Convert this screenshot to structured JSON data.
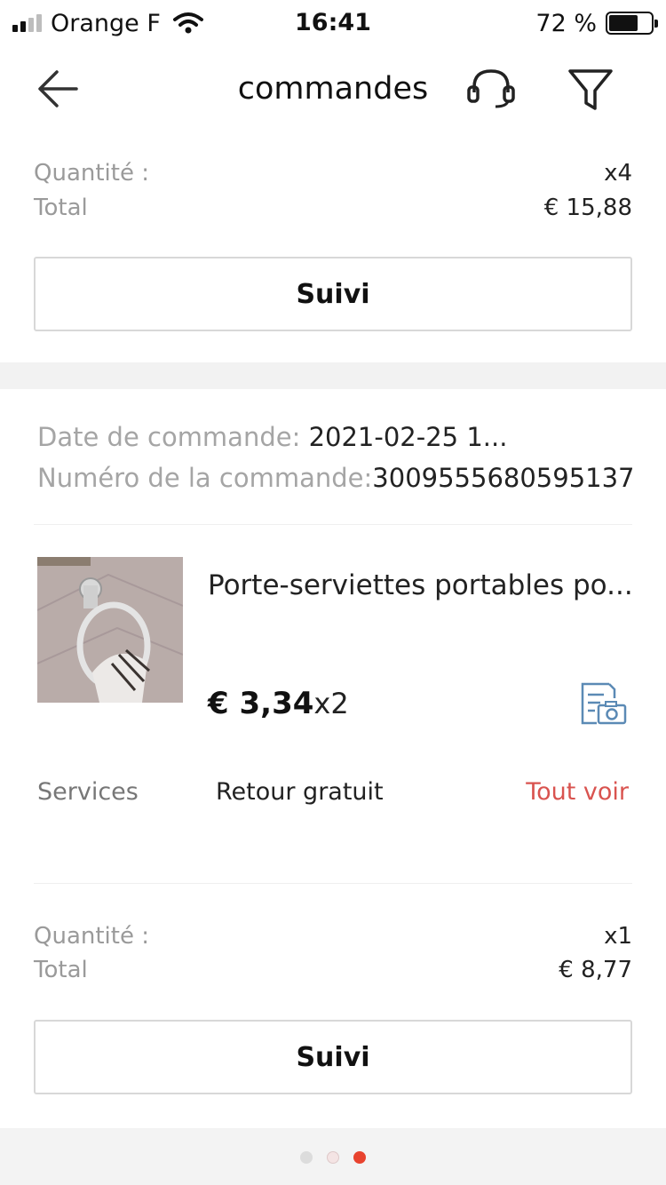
{
  "status_bar": {
    "carrier": "Orange F",
    "time": "16:41",
    "battery_percent": "72 %",
    "battery_level": 0.72,
    "signal_bars_active": 2,
    "signal_bars_total": 4
  },
  "header": {
    "title": "commandes",
    "back_icon": "arrow-left-icon",
    "support_icon": "headset-icon",
    "filter_icon": "filter-icon"
  },
  "order_prev": {
    "quantity_label": "Quantité :",
    "quantity_value": "x4",
    "total_label": "Total",
    "total_value": "€ 15,88",
    "track_button": "Suivi"
  },
  "order": {
    "date_label": "Date de commande:",
    "date_value": " 2021-02-25 1...",
    "number_label": "Numéro de la commande:",
    "number_value": "3009555680595137",
    "product": {
      "title": "Porte-serviettes portables po...",
      "price": "€ 3,34",
      "qty": "x2",
      "review_icon": "photo-review-icon"
    },
    "services": {
      "label": "Services",
      "value": "Retour gratuit",
      "link": "Tout voir"
    },
    "quantity_label": "Quantité :",
    "quantity_value": "x1",
    "total_label": "Total",
    "total_value": "€ 8,77",
    "track_button": "Suivi"
  },
  "pager": {
    "count": 3,
    "active_index": 2
  },
  "colors": {
    "accent": "#d9534f",
    "icon_blue": "#5b8ab5",
    "label_grey": "#9a9a9a",
    "band": "#f2f2f2"
  }
}
